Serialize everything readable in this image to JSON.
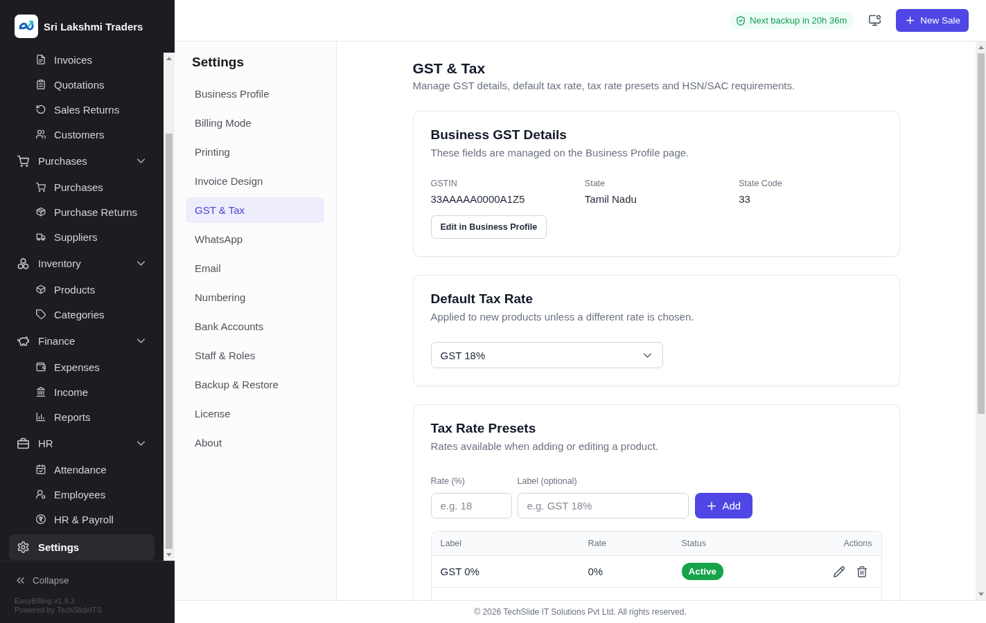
{
  "sidebar": {
    "brand": "Sri Lakshmi Traders",
    "nav": [
      {
        "expanded": true,
        "children": [
          {
            "label": "Invoices",
            "selected": false
          },
          {
            "label": "Quotations",
            "selected": false
          },
          {
            "label": "Sales Returns",
            "selected": false
          },
          {
            "label": "Customers",
            "selected": false
          }
        ]
      },
      {
        "label": "Purchases",
        "selected": false,
        "expanded": true,
        "children": [
          {
            "label": "Purchases",
            "selected": false
          },
          {
            "label": "Purchase Returns",
            "selected": false
          },
          {
            "label": "Suppliers",
            "selected": false
          }
        ]
      },
      {
        "label": "Inventory",
        "selected": false,
        "expanded": true,
        "children": [
          {
            "label": "Products",
            "selected": false
          },
          {
            "label": "Categories",
            "selected": false
          }
        ]
      },
      {
        "label": "Finance",
        "selected": false,
        "expanded": true,
        "children": [
          {
            "label": "Expenses",
            "selected": false
          },
          {
            "label": "Income",
            "selected": false
          },
          {
            "label": "Reports",
            "selected": false
          }
        ]
      },
      {
        "label": "HR",
        "selected": false,
        "expanded": true,
        "children": [
          {
            "label": "Attendance",
            "selected": false
          },
          {
            "label": "Employees",
            "selected": false
          },
          {
            "label": "HR & Payroll",
            "selected": false
          }
        ]
      },
      {
        "label": "Settings",
        "selected": true
      }
    ],
    "collapse": "Collapse",
    "version": "EasyBilling v1.9.3",
    "powered_by": "Powered by TechSlideITS"
  },
  "header": {
    "backup_status": "Next backup in 20h 36m",
    "new_sale_button": "New Sale"
  },
  "settings_nav": {
    "title": "Settings",
    "items": [
      {
        "label": "Business Profile",
        "selected": false
      },
      {
        "label": "Billing Mode",
        "selected": false
      },
      {
        "label": "Printing",
        "selected": false
      },
      {
        "label": "Invoice Design",
        "selected": false
      },
      {
        "label": "GST & Tax",
        "selected": true
      },
      {
        "label": "WhatsApp",
        "selected": false
      },
      {
        "label": "Email",
        "selected": false
      },
      {
        "label": "Numbering",
        "selected": false
      },
      {
        "label": "Bank Accounts",
        "selected": false
      },
      {
        "label": "Staff & Roles",
        "selected": false
      },
      {
        "label": "Backup & Restore",
        "selected": false
      },
      {
        "label": "License",
        "selected": false
      },
      {
        "label": "About",
        "selected": false
      }
    ]
  },
  "page": {
    "title": "GST & Tax",
    "subtitle": "Manage GST details, default tax rate, tax rate presets and HSN/SAC requirements."
  },
  "gst_details": {
    "title": "Business GST Details",
    "description": "These fields are managed on the Business Profile page.",
    "fields": [
      {
        "label": "GSTIN",
        "value": "33AAAAA0000A1Z5"
      },
      {
        "label": "State",
        "value": "Tamil Nadu"
      },
      {
        "label": "State Code",
        "value": "33"
      }
    ],
    "button": "Edit in Business Profile"
  },
  "default_tax": {
    "title": "Default Tax Rate",
    "description": "Applied to new products unless a different rate is chosen.",
    "select": {
      "value": "GST 18%"
    }
  },
  "presets": {
    "title": "Tax Rate Presets",
    "description": "Rates available when adding or editing a product.",
    "rate_field": {
      "label": "Rate (%)",
      "placeholder": "e.g. 18"
    },
    "label_field": {
      "label": "Label (optional)",
      "placeholder": "e.g. GST 18%"
    },
    "add_button": "Add",
    "table": {
      "columns": [
        "Label",
        "Rate",
        "Status",
        "Actions"
      ],
      "rows": [
        {
          "label": "GST 0%",
          "rate": "0%",
          "status": "Active",
          "active": true
        }
      ]
    }
  },
  "footer": "© 2026 TechSlide IT Solutions Pvt Ltd. All rights reserved."
}
